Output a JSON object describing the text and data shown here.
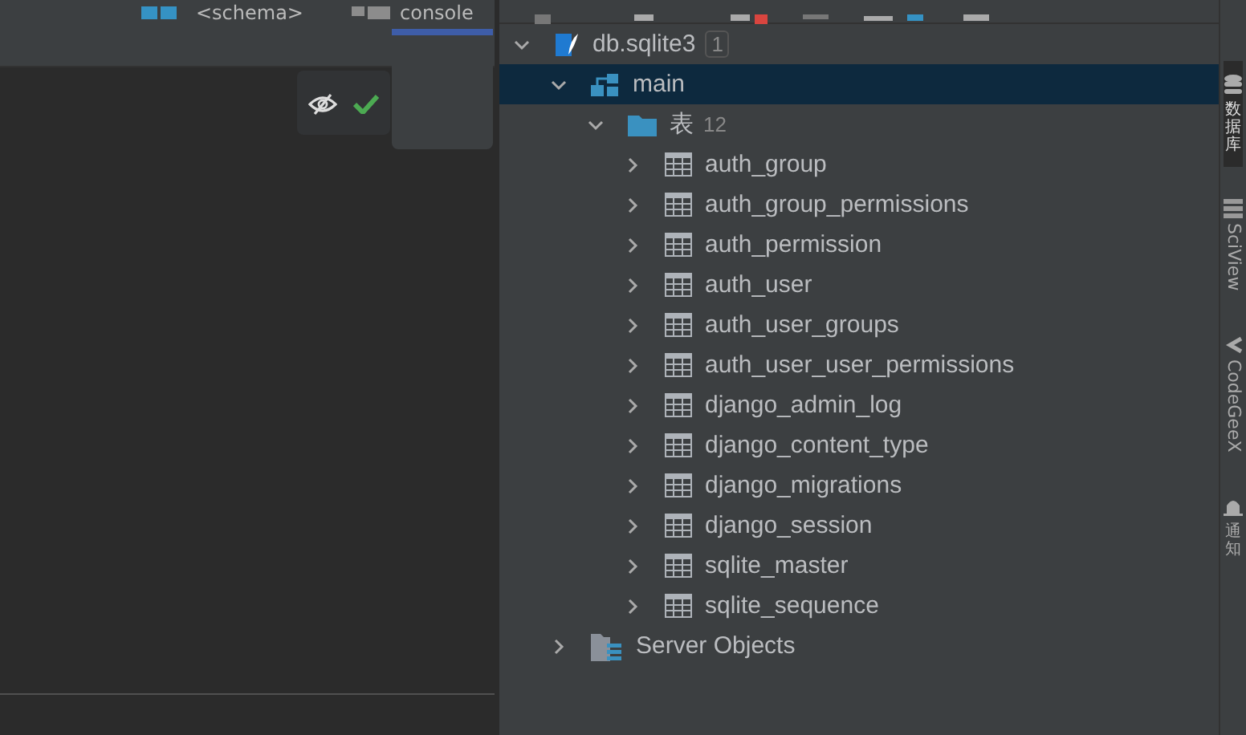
{
  "editor_tabs": [
    {
      "label": "<schema>",
      "kind": "schema"
    },
    {
      "label": "console",
      "kind": "console"
    }
  ],
  "tree": {
    "label": "db.sqlite3",
    "badge": "1",
    "expanded": true,
    "children": [
      {
        "label": "main",
        "kind": "schema",
        "expanded": true,
        "selected": true,
        "children": [
          {
            "label": "表",
            "kind": "folder",
            "count": "12",
            "expanded": true,
            "selected": false,
            "children": [
              {
                "label": "auth_group",
                "kind": "table",
                "expanded": false,
                "selected": false
              },
              {
                "label": "auth_group_permissions",
                "kind": "table",
                "expanded": false,
                "selected": false
              },
              {
                "label": "auth_permission",
                "kind": "table",
                "expanded": false,
                "selected": false
              },
              {
                "label": "auth_user",
                "kind": "table",
                "expanded": false,
                "selected": false
              },
              {
                "label": "auth_user_groups",
                "kind": "table",
                "expanded": false,
                "selected": false
              },
              {
                "label": "auth_user_user_permissions",
                "kind": "table",
                "expanded": false,
                "selected": false
              },
              {
                "label": "django_admin_log",
                "kind": "table",
                "expanded": false,
                "selected": false
              },
              {
                "label": "django_content_type",
                "kind": "table",
                "expanded": false,
                "selected": false
              },
              {
                "label": "django_migrations",
                "kind": "table",
                "expanded": false,
                "selected": false
              },
              {
                "label": "django_session",
                "kind": "table",
                "expanded": false,
                "selected": false
              },
              {
                "label": "sqlite_master",
                "kind": "table",
                "expanded": false,
                "selected": false
              },
              {
                "label": "sqlite_sequence",
                "kind": "table",
                "expanded": false,
                "selected": false
              }
            ]
          }
        ]
      },
      {
        "label": "Server Objects",
        "kind": "server",
        "expanded": false,
        "selected": false
      }
    ]
  },
  "side_tools": [
    {
      "label": "数据库",
      "kind": "database",
      "selected": true
    },
    {
      "label": "SciView",
      "kind": "sciview",
      "selected": false
    },
    {
      "label": "CodeGeeX",
      "kind": "codegeex",
      "selected": false
    },
    {
      "label": "通知",
      "kind": "bell",
      "selected": false
    }
  ]
}
